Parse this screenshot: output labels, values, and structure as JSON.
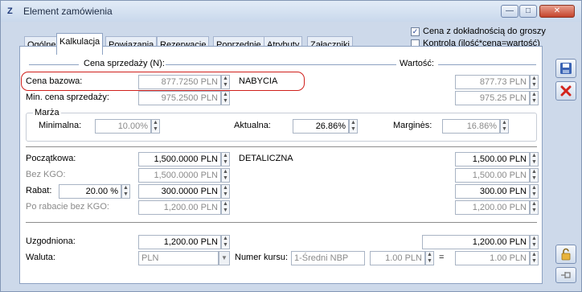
{
  "window": {
    "icon": "Z",
    "title": "Element zamówienia",
    "min": "—",
    "max": "□",
    "close": "✕"
  },
  "tabs": [
    "Ogólne",
    "Kalkulacja",
    "Powiązania",
    "Rezerwacje",
    "Poprzednie",
    "Atrybuty",
    "Załączniki"
  ],
  "options": {
    "cena_dokladnosc": {
      "label": "Cena z dokładnością do groszy",
      "checked": true
    },
    "kontrola": {
      "label": "Kontrola (ilość*cena=wartość)",
      "checked": false
    }
  },
  "section_titles": {
    "cena": "Cena sprzedaży (N):",
    "wartosc": "Wartość:",
    "marza": "Marża"
  },
  "prices": {
    "cena_bazowa": {
      "label": "Cena bazowa:",
      "value": "877.7250 PLN",
      "type": "NABYCIA",
      "wartosc": "877.73 PLN"
    },
    "min_cena": {
      "label": "Min. cena sprzedaży:",
      "value": "975.2500 PLN",
      "wartosc": "975.25 PLN"
    }
  },
  "marza": {
    "minimalna_label": "Minimalna:",
    "minimalna": "10.00%",
    "aktualna_label": "Aktualna:",
    "aktualna": "26.86%",
    "margines_label": "Marginės:",
    "margines": "16.86%"
  },
  "pricing": {
    "poczatkowa": {
      "label": "Początkowa:",
      "value": "1,500.0000 PLN",
      "type": "DETALICZNA",
      "wartosc": "1,500.00 PLN"
    },
    "bez_kgo": {
      "label": "Bez KGO:",
      "value": "1,500.0000 PLN",
      "wartosc": "1,500.00 PLN"
    },
    "rabat": {
      "label": "Rabat:",
      "percent": "20.00 %",
      "value": "300.0000 PLN",
      "wartosc": "300.00 PLN"
    },
    "po_rabacie": {
      "label": "Po rabacie bez KGO:",
      "value": "1,200.00 PLN",
      "wartosc": "1,200.00 PLN"
    }
  },
  "final": {
    "uzgodniona": {
      "label": "Uzgodniona:",
      "value": "1,200.00 PLN",
      "wartosc": "1,200.00 PLN"
    },
    "waluta": {
      "label": "Waluta:",
      "value": "PLN"
    },
    "kurs": {
      "label": "Numer kursu:",
      "value": "1-Średni NBP",
      "rate": "1.00 PLN",
      "eq": "=",
      "result": "1.00 PLN"
    }
  },
  "icons": {
    "save": "save-icon",
    "cancel": "cancel-icon",
    "lock": "lock-icon",
    "pin": "pin-icon"
  }
}
